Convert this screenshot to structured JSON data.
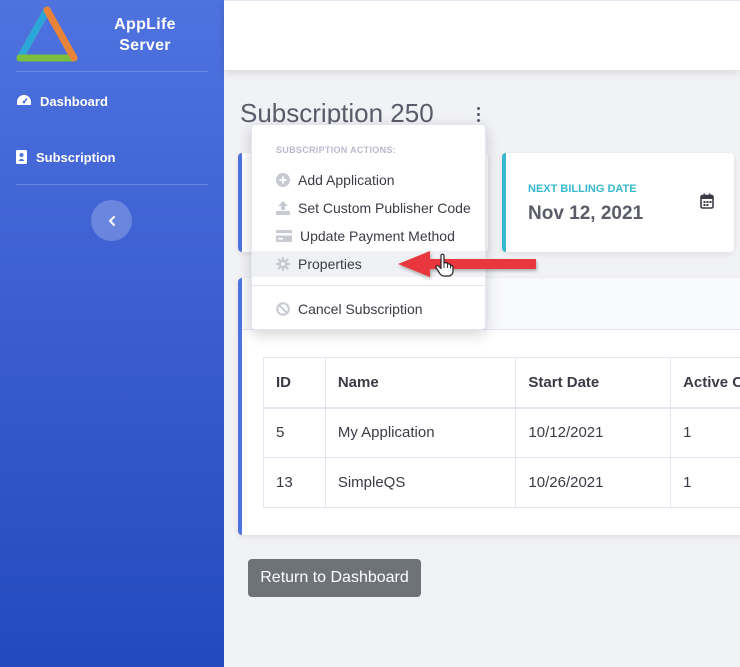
{
  "brand": {
    "name_line1": "AppLife",
    "name_line2": "Server",
    "logo": "triangle-logo"
  },
  "sidebar": {
    "items": [
      {
        "label": "Dashboard",
        "icon": "speedometer-icon"
      },
      {
        "label": "Subscription",
        "icon": "address-book-icon"
      }
    ],
    "toggle_icon": "chevron-left-icon"
  },
  "page": {
    "title": "Subscription 250",
    "menu_icon": "kebab-icon"
  },
  "billing": {
    "label": "NEXT BILLING DATE",
    "value": "Nov 12, 2021",
    "icon": "calendar-icon"
  },
  "dropdown": {
    "header": "SUBSCRIPTION ACTIONS:",
    "items": [
      {
        "label": "Add Application",
        "icon": "plus-circle-icon"
      },
      {
        "label": "Set Custom Publisher Code",
        "icon": "upload-icon"
      },
      {
        "label": "Update Payment Method",
        "icon": "credit-card-icon"
      },
      {
        "label": "Properties",
        "icon": "gear-icon"
      },
      {
        "label": "Cancel Subscription",
        "icon": "ban-icon"
      }
    ],
    "hovered": "Properties"
  },
  "table": {
    "headers": [
      "ID",
      "Name",
      "Start Date",
      "Active C"
    ],
    "rows": [
      [
        "5",
        "My Application",
        "10/12/2021",
        "1"
      ],
      [
        "13",
        "SimpleQS",
        "10/26/2021",
        "1"
      ]
    ]
  },
  "buttons": {
    "return": "Return to Dashboard"
  },
  "colors": {
    "sidebar": "#4e73df",
    "primary_border": "#4e73df",
    "info": "#36b9cc",
    "annotation_arrow": "#e8383d",
    "button": "#6e7379"
  }
}
